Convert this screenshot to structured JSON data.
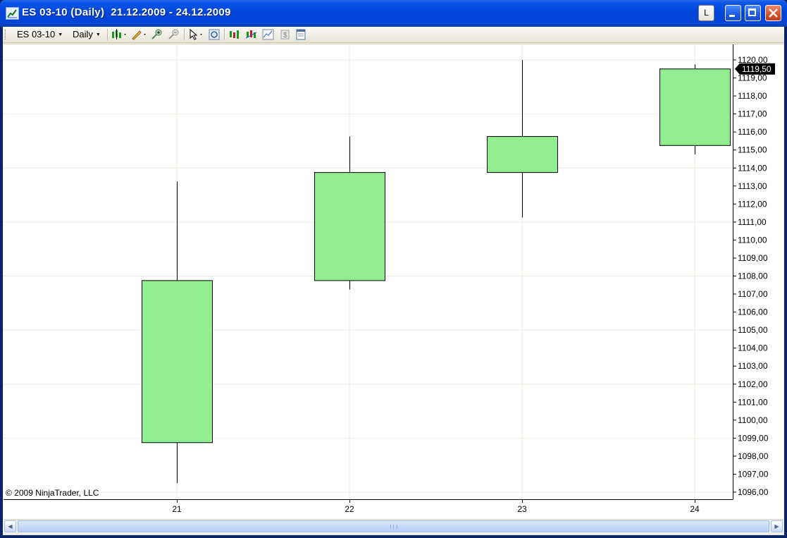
{
  "window": {
    "title": "ES 03-10 (Daily)  21.12.2009 - 24.12.2009",
    "link_button_label": "L"
  },
  "toolbar": {
    "instrument": "ES 03-10",
    "period": "Daily",
    "icons": [
      "candlestick-style-icon",
      "drawing-tool-icon",
      "zoom-in-icon",
      "zoom-out-icon",
      "cursor-icon",
      "properties-icon",
      "instrument-icon",
      "indicators-icon",
      "strategies-icon",
      "dollar-icon",
      "data-box-icon"
    ]
  },
  "chart_data": {
    "type": "candlestick",
    "copyright": "© 2009 NinjaTrader, LLC",
    "x": [
      "21",
      "22",
      "23",
      "24"
    ],
    "candles": [
      {
        "x": "21",
        "open": 1098.75,
        "high": 1113.25,
        "low": 1096.5,
        "close": 1107.75
      },
      {
        "x": "22",
        "open": 1107.75,
        "high": 1115.75,
        "low": 1107.25,
        "close": 1113.75
      },
      {
        "x": "23",
        "open": 1113.75,
        "high": 1120.0,
        "low": 1111.25,
        "close": 1115.75
      },
      {
        "x": "24",
        "open": 1115.25,
        "high": 1119.75,
        "low": 1114.75,
        "close": 1119.5
      }
    ],
    "ylim": [
      1096,
      1120
    ],
    "yticks": [
      "1096,00",
      "1097,00",
      "1098,00",
      "1099,00",
      "1100,00",
      "1101,00",
      "1102,00",
      "1103,00",
      "1104,00",
      "1105,00",
      "1106,00",
      "1107,00",
      "1108,00",
      "1109,00",
      "1110,00",
      "1111,00",
      "1112,00",
      "1113,00",
      "1114,00",
      "1115,00",
      "1116,00",
      "1117,00",
      "1118,00",
      "1119,00",
      "1120,00"
    ],
    "last_price_label": "1119,50",
    "last_price": 1119.5,
    "up_color": "#90ee90",
    "outline_color": "#000000",
    "grid_color": "#eeeee0"
  }
}
